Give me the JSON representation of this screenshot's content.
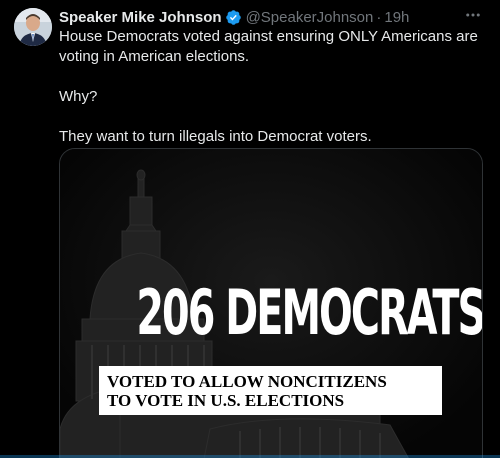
{
  "post": {
    "author_name": "Speaker Mike Johnson",
    "handle": "@SpeakerJohnson",
    "separator": "·",
    "time": "19h",
    "verified_icon": "verified-badge-icon",
    "more_icon": "more-options-icon",
    "text_lines": [
      "House Democrats voted against ensuring ONLY Americans are voting in American elections.",
      "Why?",
      "They want to turn illegals into Democrat voters."
    ]
  },
  "media": {
    "headline": "206 DEMOCRATS",
    "caption_line1": "VOTED TO ALLOW NONCITIZENS",
    "caption_line2": "TO VOTE IN U.S. ELECTIONS"
  },
  "colors": {
    "background": "#000000",
    "text": "#e7e9ea",
    "secondary_text": "#71767b",
    "verified": "#1d9bf0",
    "accent": "#1d9bf0"
  }
}
